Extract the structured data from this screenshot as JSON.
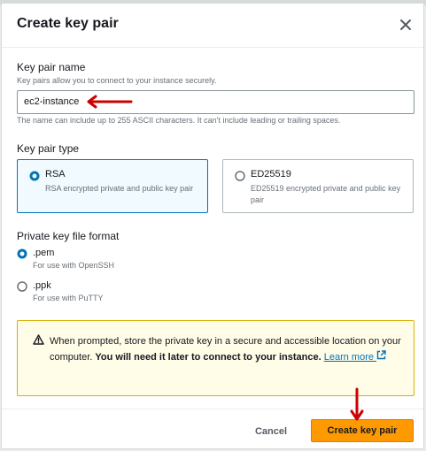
{
  "modal": {
    "title": "Create key pair"
  },
  "key_pair_name": {
    "label": "Key pair name",
    "description": "Key pairs allow you to connect to your instance securely.",
    "value": "ec2-instance",
    "constraint": "The name can include up to 255 ASCII characters. It can't include leading or trailing spaces."
  },
  "key_pair_type": {
    "label": "Key pair type",
    "options": [
      {
        "label": "RSA",
        "description": "RSA encrypted private and public key pair",
        "selected": true
      },
      {
        "label": "ED25519",
        "description": "ED25519 encrypted private and public key pair",
        "selected": false
      }
    ]
  },
  "file_format": {
    "label": "Private key file format",
    "options": [
      {
        "label": ".pem",
        "description": "For use with OpenSSH",
        "selected": true
      },
      {
        "label": ".ppk",
        "description": "For use with PuTTY",
        "selected": false
      }
    ]
  },
  "alert": {
    "text_plain": "When prompted, store the private key in a secure and accessible location on your computer.",
    "text_bold": "You will need it later to connect to your instance.",
    "link": "Learn more"
  },
  "footer": {
    "cancel_label": "Cancel",
    "create_label": "Create key pair"
  },
  "colors": {
    "primary_button": "#ff9900",
    "selected_border": "#0073bb",
    "annotation_arrow": "#cc0000",
    "alert_border": "#d8b000"
  }
}
